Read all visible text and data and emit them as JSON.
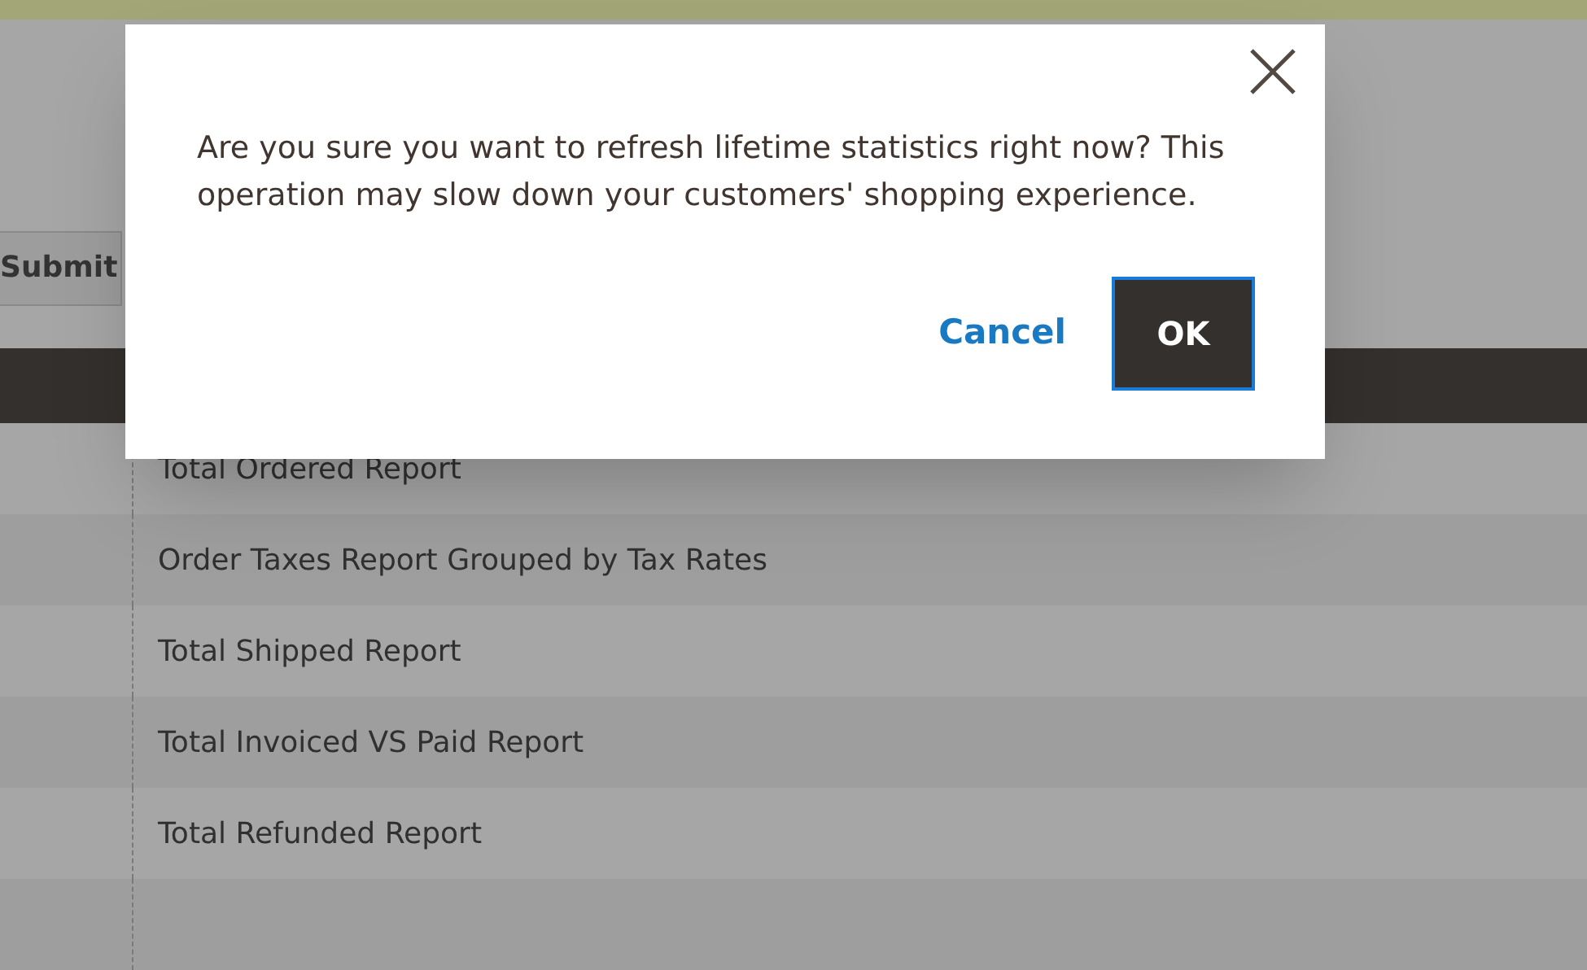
{
  "toolbar": {
    "submit_button": "Submit"
  },
  "table": {
    "rows": [
      {
        "column_2": "Total Ordered Report"
      },
      {
        "column_2": "Order Taxes Report Grouped by Tax Rates"
      },
      {
        "column_2": "Total Shipped Report"
      },
      {
        "column_2": "Total Invoiced VS Paid Report"
      },
      {
        "column_2": "Total Refunded Report"
      }
    ]
  },
  "dialog": {
    "message": "Are you sure you want to refresh lifetime statistics right now? This operation may slow down your customers' shopping experience.",
    "buttons": [
      {
        "kind": "link",
        "label": "Cancel"
      },
      {
        "kind": "primary",
        "label": "OK"
      }
    ]
  }
}
